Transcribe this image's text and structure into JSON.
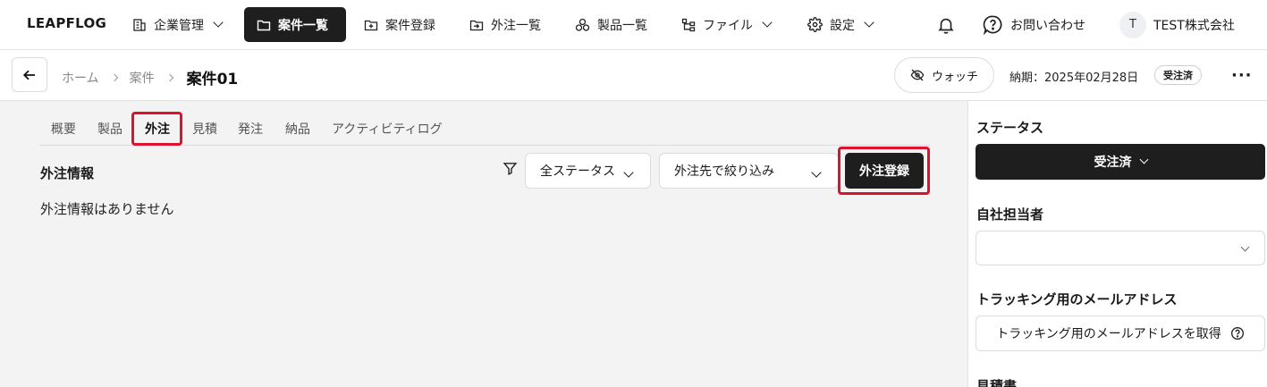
{
  "header": {
    "logo": "LEAPFLOG",
    "nav": [
      {
        "label": "企業管理",
        "icon": "building-icon"
      },
      {
        "label": "案件一覧",
        "icon": "folder-icon"
      },
      {
        "label": "案件登録",
        "icon": "folder-plus-icon"
      },
      {
        "label": "外注一覧",
        "icon": "folder-export-icon"
      },
      {
        "label": "製品一覧",
        "icon": "boxes-icon"
      },
      {
        "label": "ファイル",
        "icon": "file-tree-icon"
      },
      {
        "label": "設定",
        "icon": "gear-icon"
      }
    ],
    "contact_label": "お問い合わせ",
    "avatar_initial": "T",
    "company_name": "TEST株式会社"
  },
  "subheader": {
    "breadcrumb": [
      "ホーム",
      "案件"
    ],
    "title": "案件01",
    "watch_label": "ウォッチ",
    "deadline": "納期：2025年02月28日",
    "status_badge": "受注済",
    "more": "···"
  },
  "tabs": [
    "概要",
    "製品",
    "外注",
    "見積",
    "発注",
    "納品",
    "アクティビティログ"
  ],
  "active_tab": "外注",
  "outsourcing": {
    "section_title": "外注情報",
    "status_filter": "全ステータス",
    "vendor_filter": "外注先で絞り込み",
    "register_button": "外注登録",
    "empty_message": "外注情報はありません"
  },
  "sidebar": {
    "status_label": "ステータス",
    "status_value": "受注済",
    "assignee_label": "自社担当者",
    "assignee_value": "",
    "tracking_label": "トラッキング用のメールアドレス",
    "tracking_button": "トラッキング用のメールアドレスを取得",
    "estimate_label": "見積書"
  },
  "colors": {
    "highlight": "#e0102f",
    "primary": "#1e1e1e"
  }
}
